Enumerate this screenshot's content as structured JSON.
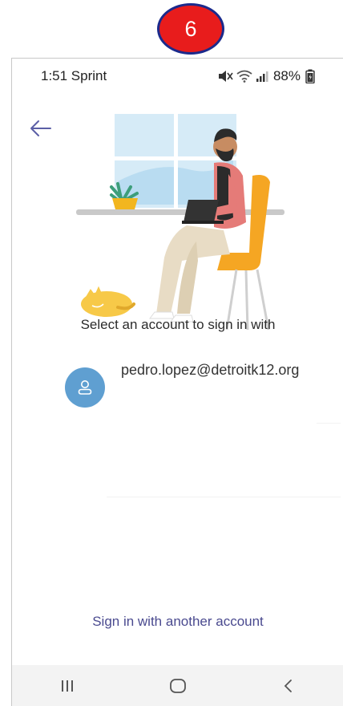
{
  "step_badge": "6",
  "status_bar": {
    "time_carrier": "1:51 Sprint",
    "battery": "88%",
    "icons": [
      "mute-icon",
      "wifi-icon",
      "signal-icon",
      "battery-icon"
    ]
  },
  "login": {
    "prompt": "Select an account to sign in with",
    "accounts": [
      {
        "email": "pedro.lopez@detroitk12.org"
      }
    ],
    "another_account": "Sign in with another account"
  },
  "navigation": {
    "buttons": [
      "recent-apps-icon",
      "home-icon",
      "back-icon"
    ]
  },
  "colors": {
    "badge": "#e81c1c",
    "badge_border": "#1b2a8c",
    "avatar": "#5f9fd1",
    "link": "#4a4a8f",
    "accent": "#6264a7"
  }
}
